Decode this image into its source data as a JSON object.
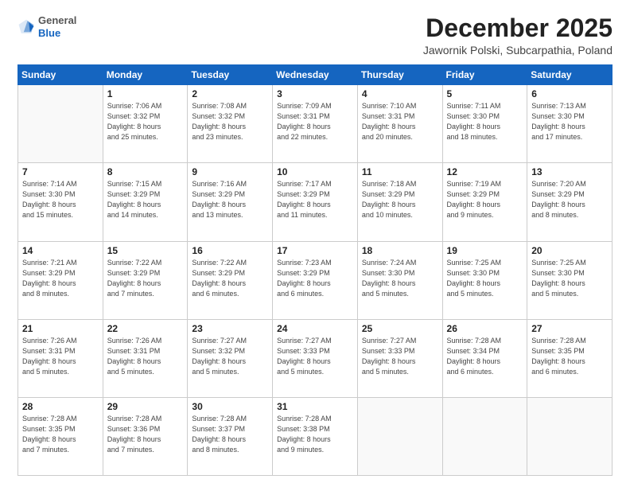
{
  "header": {
    "logo_line1": "General",
    "logo_line2": "Blue",
    "title": "December 2025",
    "location": "Jawornik Polski, Subcarpathia, Poland"
  },
  "days_of_week": [
    "Sunday",
    "Monday",
    "Tuesday",
    "Wednesday",
    "Thursday",
    "Friday",
    "Saturday"
  ],
  "weeks": [
    [
      {
        "day": "",
        "info": ""
      },
      {
        "day": "1",
        "info": "Sunrise: 7:06 AM\nSunset: 3:32 PM\nDaylight: 8 hours\nand 25 minutes."
      },
      {
        "day": "2",
        "info": "Sunrise: 7:08 AM\nSunset: 3:32 PM\nDaylight: 8 hours\nand 23 minutes."
      },
      {
        "day": "3",
        "info": "Sunrise: 7:09 AM\nSunset: 3:31 PM\nDaylight: 8 hours\nand 22 minutes."
      },
      {
        "day": "4",
        "info": "Sunrise: 7:10 AM\nSunset: 3:31 PM\nDaylight: 8 hours\nand 20 minutes."
      },
      {
        "day": "5",
        "info": "Sunrise: 7:11 AM\nSunset: 3:30 PM\nDaylight: 8 hours\nand 18 minutes."
      },
      {
        "day": "6",
        "info": "Sunrise: 7:13 AM\nSunset: 3:30 PM\nDaylight: 8 hours\nand 17 minutes."
      }
    ],
    [
      {
        "day": "7",
        "info": "Sunrise: 7:14 AM\nSunset: 3:30 PM\nDaylight: 8 hours\nand 15 minutes."
      },
      {
        "day": "8",
        "info": "Sunrise: 7:15 AM\nSunset: 3:29 PM\nDaylight: 8 hours\nand 14 minutes."
      },
      {
        "day": "9",
        "info": "Sunrise: 7:16 AM\nSunset: 3:29 PM\nDaylight: 8 hours\nand 13 minutes."
      },
      {
        "day": "10",
        "info": "Sunrise: 7:17 AM\nSunset: 3:29 PM\nDaylight: 8 hours\nand 11 minutes."
      },
      {
        "day": "11",
        "info": "Sunrise: 7:18 AM\nSunset: 3:29 PM\nDaylight: 8 hours\nand 10 minutes."
      },
      {
        "day": "12",
        "info": "Sunrise: 7:19 AM\nSunset: 3:29 PM\nDaylight: 8 hours\nand 9 minutes."
      },
      {
        "day": "13",
        "info": "Sunrise: 7:20 AM\nSunset: 3:29 PM\nDaylight: 8 hours\nand 8 minutes."
      }
    ],
    [
      {
        "day": "14",
        "info": "Sunrise: 7:21 AM\nSunset: 3:29 PM\nDaylight: 8 hours\nand 8 minutes."
      },
      {
        "day": "15",
        "info": "Sunrise: 7:22 AM\nSunset: 3:29 PM\nDaylight: 8 hours\nand 7 minutes."
      },
      {
        "day": "16",
        "info": "Sunrise: 7:22 AM\nSunset: 3:29 PM\nDaylight: 8 hours\nand 6 minutes."
      },
      {
        "day": "17",
        "info": "Sunrise: 7:23 AM\nSunset: 3:29 PM\nDaylight: 8 hours\nand 6 minutes."
      },
      {
        "day": "18",
        "info": "Sunrise: 7:24 AM\nSunset: 3:30 PM\nDaylight: 8 hours\nand 5 minutes."
      },
      {
        "day": "19",
        "info": "Sunrise: 7:25 AM\nSunset: 3:30 PM\nDaylight: 8 hours\nand 5 minutes."
      },
      {
        "day": "20",
        "info": "Sunrise: 7:25 AM\nSunset: 3:30 PM\nDaylight: 8 hours\nand 5 minutes."
      }
    ],
    [
      {
        "day": "21",
        "info": "Sunrise: 7:26 AM\nSunset: 3:31 PM\nDaylight: 8 hours\nand 5 minutes."
      },
      {
        "day": "22",
        "info": "Sunrise: 7:26 AM\nSunset: 3:31 PM\nDaylight: 8 hours\nand 5 minutes."
      },
      {
        "day": "23",
        "info": "Sunrise: 7:27 AM\nSunset: 3:32 PM\nDaylight: 8 hours\nand 5 minutes."
      },
      {
        "day": "24",
        "info": "Sunrise: 7:27 AM\nSunset: 3:33 PM\nDaylight: 8 hours\nand 5 minutes."
      },
      {
        "day": "25",
        "info": "Sunrise: 7:27 AM\nSunset: 3:33 PM\nDaylight: 8 hours\nand 5 minutes."
      },
      {
        "day": "26",
        "info": "Sunrise: 7:28 AM\nSunset: 3:34 PM\nDaylight: 8 hours\nand 6 minutes."
      },
      {
        "day": "27",
        "info": "Sunrise: 7:28 AM\nSunset: 3:35 PM\nDaylight: 8 hours\nand 6 minutes."
      }
    ],
    [
      {
        "day": "28",
        "info": "Sunrise: 7:28 AM\nSunset: 3:35 PM\nDaylight: 8 hours\nand 7 minutes."
      },
      {
        "day": "29",
        "info": "Sunrise: 7:28 AM\nSunset: 3:36 PM\nDaylight: 8 hours\nand 7 minutes."
      },
      {
        "day": "30",
        "info": "Sunrise: 7:28 AM\nSunset: 3:37 PM\nDaylight: 8 hours\nand 8 minutes."
      },
      {
        "day": "31",
        "info": "Sunrise: 7:28 AM\nSunset: 3:38 PM\nDaylight: 8 hours\nand 9 minutes."
      },
      {
        "day": "",
        "info": ""
      },
      {
        "day": "",
        "info": ""
      },
      {
        "day": "",
        "info": ""
      }
    ]
  ]
}
